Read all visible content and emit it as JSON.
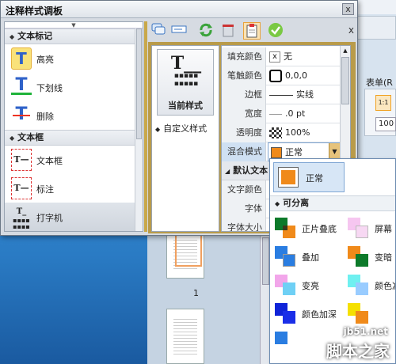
{
  "window": {
    "title": "注释样式调板",
    "close_glyph": "x"
  },
  "left_panel": {
    "grip": "▼",
    "sections": [
      {
        "label": "文本标记",
        "tools": [
          {
            "label": "高亮",
            "icon": "highlight-icon",
            "glyph": "T"
          },
          {
            "label": "下划线",
            "icon": "underline-icon",
            "glyph": "T"
          },
          {
            "label": "删除",
            "icon": "strikeout-icon",
            "glyph": "T"
          }
        ]
      },
      {
        "label": "文本框",
        "tools": [
          {
            "label": "文本框",
            "icon": "textbox-icon",
            "glyph": "T—"
          },
          {
            "label": "标注",
            "icon": "callout-icon",
            "glyph": "T—"
          },
          {
            "label": "打字机",
            "icon": "typewriter-icon",
            "glyph": "T_"
          }
        ]
      }
    ]
  },
  "toolbar": {
    "close_glyph": "x"
  },
  "styles_panel": {
    "current_label": "当前样式",
    "custom_label": "自定义样式",
    "icon_glyph": "T__",
    "icon_dots": "▦▦▦▦\n▦▦▦▦"
  },
  "properties": {
    "fill_color": {
      "label": "填充颜色",
      "value": "无",
      "swatch": "x"
    },
    "stroke_color": {
      "label": "笔触颜色",
      "value": "0,0,0"
    },
    "border": {
      "label": "边框",
      "value": "实线"
    },
    "width": {
      "label": "宽度",
      "value": ".0 pt"
    },
    "opacity": {
      "label": "透明度",
      "value": "100%"
    },
    "blend_mode": {
      "label": "混合模式",
      "value": "正常"
    },
    "default_text_section": "默认文本",
    "text_color": {
      "label": "文字颜色"
    },
    "font": {
      "label": "字体"
    },
    "font_size": {
      "label": "字体大小"
    }
  },
  "blend_dropdown": {
    "selected": "正常",
    "section": "可分离",
    "options": [
      "正片叠底",
      "屏幕",
      "叠加",
      "变暗",
      "变亮",
      "颜色减",
      "颜色加深",
      ""
    ]
  },
  "background_app": {
    "menu_label": "表单(R",
    "tool_label": "1:1",
    "zoom": "100"
  },
  "thumbnails": {
    "page_number": "1"
  },
  "watermark": {
    "url": "jb51.net",
    "logo": "脚本之家"
  },
  "colors": {
    "accent": "#f0a030",
    "selection": "#cfe0f2",
    "blend_orange": "#f08a1a"
  }
}
